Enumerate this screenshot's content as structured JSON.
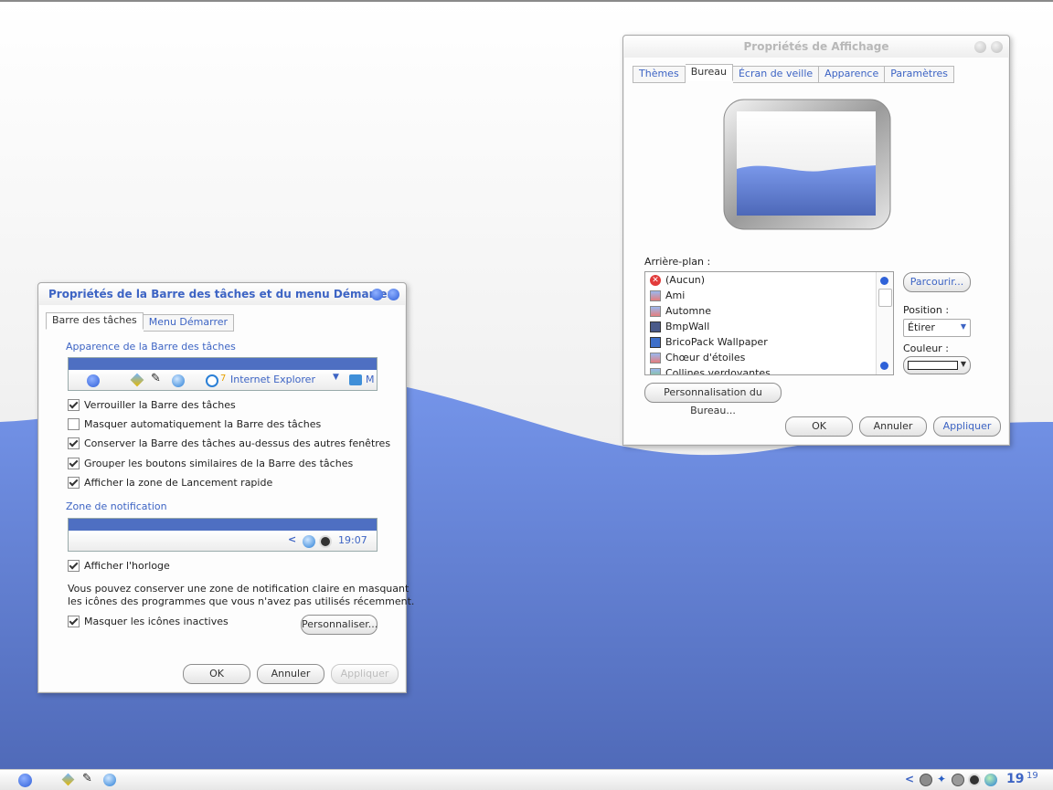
{
  "colors": {
    "accent": "#3d64c4",
    "wave": "#6f8fe2",
    "wave_dark": "#4a66b8",
    "title_gray": "#b8b8b8"
  },
  "taskbar_window": {
    "title": "Propriétés de la Barre des tâches et du menu Démarrer",
    "tabs": [
      {
        "label": "Barre des tâches",
        "active": true
      },
      {
        "label": "Menu Démarrer",
        "active": false
      }
    ],
    "section_appearance": "Apparence de la Barre des tâches",
    "preview_ie_label": "Internet Explorer",
    "preview_ie_badge": "7",
    "preview_more": "M",
    "checkboxes": [
      {
        "label": "Verrouiller la Barre des tâches",
        "checked": true
      },
      {
        "label": "Masquer automatiquement la Barre des tâches",
        "checked": false
      },
      {
        "label": "Conserver la Barre des tâches au-dessus des autres fenêtres",
        "checked": true
      },
      {
        "label": "Grouper les boutons similaires de la Barre des tâches",
        "checked": true
      },
      {
        "label": "Afficher la zone de Lancement rapide",
        "checked": true
      }
    ],
    "section_notification": "Zone de notification",
    "notif_time": "19:07",
    "notif_arrow": "<",
    "show_clock": {
      "label": "Afficher l'horloge",
      "checked": true
    },
    "description_line1": "Vous pouvez conserver une zone de notification claire en masquant",
    "description_line2": "les icônes des programmes que vous n'avez pas utilisés récemment.",
    "hide_inactive": {
      "label": "Masquer les icônes inactives",
      "checked": true
    },
    "customize_button": "Personnaliser...",
    "ok_button": "OK",
    "cancel_button": "Annuler",
    "apply_button": "Appliquer"
  },
  "display_window": {
    "title": "Propriétés de Affichage",
    "tabs": [
      {
        "label": "Thèmes",
        "active": false
      },
      {
        "label": "Bureau",
        "active": true
      },
      {
        "label": "Écran de veille",
        "active": false
      },
      {
        "label": "Apparence",
        "active": false
      },
      {
        "label": "Paramètres",
        "active": false
      }
    ],
    "background_label": "Arrière-plan :",
    "backgrounds": [
      "(Aucun)",
      "Ami",
      "Automne",
      "BmpWall",
      "BricoPack Wallpaper",
      "Chœur d'étoiles",
      "Collines verdoyantes"
    ],
    "browse_button": "Parcourir...",
    "position_label": "Position :",
    "position_value": "Étirer",
    "color_label": "Couleur :",
    "customize_desktop_button": "Personnalisation du Bureau...",
    "ok_button": "OK",
    "cancel_button": "Annuler",
    "apply_button": "Appliquer"
  },
  "system_taskbar": {
    "clock_hour": "19",
    "clock_minute": "19",
    "tray_arrow": "<"
  }
}
